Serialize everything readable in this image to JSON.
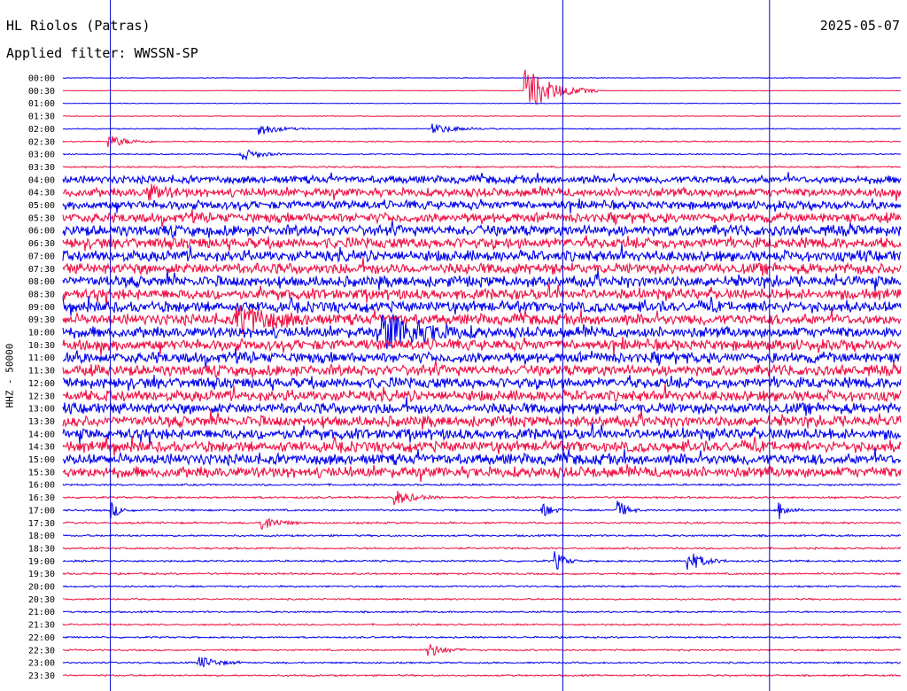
{
  "header": {
    "station": "HL Riolos (Patras)",
    "date": "2025-05-07",
    "filter": "Applied filter: WWSSN-SP"
  },
  "colors": {
    "trace_a": "#0000ee",
    "trace_b": "#ee1144",
    "marker": "#0000cc"
  },
  "chart_data": {
    "type": "line",
    "title": "HL Riolos (Patras)",
    "subtitle": "Applied filter: WWSSN-SP",
    "date": "2025-05-07",
    "ylabel": "HHZ - 50000",
    "xlabel": "",
    "rows": [
      "00:00",
      "00:30",
      "01:00",
      "01:30",
      "02:00",
      "02:30",
      "03:00",
      "03:30",
      "04:00",
      "04:30",
      "05:00",
      "05:30",
      "06:00",
      "06:30",
      "07:00",
      "07:30",
      "08:00",
      "08:30",
      "09:00",
      "09:30",
      "10:00",
      "10:30",
      "11:00",
      "11:30",
      "12:00",
      "12:30",
      "13:00",
      "13:30",
      "14:00",
      "14:30",
      "15:00",
      "15:30",
      "16:00",
      "16:30",
      "17:00",
      "17:30",
      "18:00",
      "18:30",
      "19:00",
      "19:30",
      "20:00",
      "20:30",
      "21:00",
      "21:30",
      "22:00",
      "22:30",
      "23:00",
      "23:30"
    ],
    "row_minutes": 30,
    "row_colors": [
      "blue",
      "red"
    ],
    "noise_level": [
      0.3,
      0.3,
      0.3,
      0.3,
      0.5,
      0.6,
      0.6,
      0.8,
      3.5,
      4,
      4,
      4.5,
      5,
      5,
      5,
      5,
      5,
      5,
      5,
      5,
      5,
      5,
      5,
      5,
      5,
      5,
      5,
      5,
      5,
      5,
      5,
      5,
      0.9,
      0.9,
      0.9,
      0.9,
      0.9,
      0.9,
      0.9,
      0.9,
      0.8,
      0.8,
      0.8,
      0.8,
      0.8,
      0.8,
      0.8,
      0.8
    ],
    "events": [
      {
        "row": "00:30",
        "minute": 16.5,
        "amp": 28,
        "duration": 0.9
      },
      {
        "row": "02:00",
        "minute": 7.0,
        "amp": 8,
        "duration": 0.6
      },
      {
        "row": "02:00",
        "minute": 13.2,
        "amp": 6,
        "duration": 0.8
      },
      {
        "row": "02:30",
        "minute": 1.6,
        "amp": 8,
        "duration": 0.6
      },
      {
        "row": "03:00",
        "minute": 6.3,
        "amp": 8,
        "duration": 0.6
      },
      {
        "row": "04:30",
        "minute": 3.0,
        "amp": 8,
        "duration": 0.5
      },
      {
        "row": "09:30",
        "minute": 6.2,
        "amp": 18,
        "duration": 1.0
      },
      {
        "row": "10:00",
        "minute": 11.4,
        "amp": 22,
        "duration": 1.2
      },
      {
        "row": "16:30",
        "minute": 11.8,
        "amp": 10,
        "duration": 0.6
      },
      {
        "row": "17:00",
        "minute": 1.7,
        "amp": 10,
        "duration": 0.3
      },
      {
        "row": "17:00",
        "minute": 17.1,
        "amp": 12,
        "duration": 0.3
      },
      {
        "row": "17:00",
        "minute": 19.8,
        "amp": 14,
        "duration": 0.3
      },
      {
        "row": "17:00",
        "minute": 25.6,
        "amp": 12,
        "duration": 0.3
      },
      {
        "row": "17:30",
        "minute": 7.1,
        "amp": 10,
        "duration": 0.5
      },
      {
        "row": "19:00",
        "minute": 22.3,
        "amp": 14,
        "duration": 0.5
      },
      {
        "row": "19:00",
        "minute": 17.6,
        "amp": 12,
        "duration": 0.3
      },
      {
        "row": "22:30",
        "minute": 13.0,
        "amp": 10,
        "duration": 0.5
      },
      {
        "row": "23:00",
        "minute": 4.8,
        "amp": 8,
        "duration": 0.6
      }
    ],
    "markers_minute": [
      1.7,
      17.9,
      25.3
    ],
    "legend": "none",
    "grid": false
  }
}
